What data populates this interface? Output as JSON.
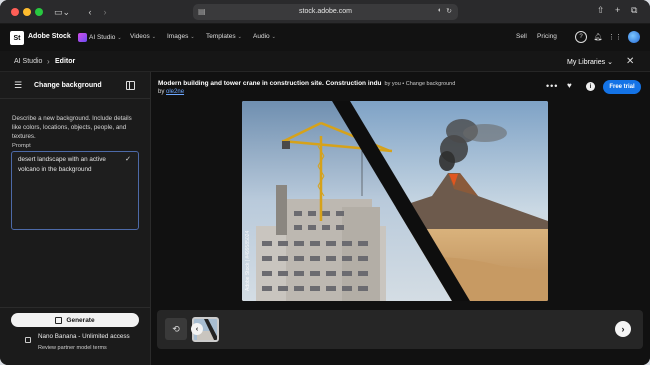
{
  "browser": {
    "url": "stock.adobe.com",
    "icons": [
      "sidebar-icon",
      "back-icon",
      "forward-icon",
      "reader-icon",
      "translate-icon",
      "reload-icon",
      "share-icon",
      "new-tab-icon",
      "tabs-icon"
    ]
  },
  "header": {
    "logo": "St",
    "brand": "Adobe Stock",
    "menu": [
      {
        "label": "AI Studio"
      },
      {
        "label": "Videos"
      },
      {
        "label": "Images"
      },
      {
        "label": "Templates"
      },
      {
        "label": "Audio"
      }
    ],
    "sell": "Sell",
    "pricing": "Pricing"
  },
  "subheader": {
    "crumb_root": "AI Studio",
    "crumb_current": "Editor",
    "my_libraries": "My Libraries"
  },
  "left_panel": {
    "title": "Change background",
    "description": "Describe a new background. Include details like colors, locations, objects, people, and textures.",
    "prompt_label": "Prompt",
    "prompt_value": "desert landscape with an active volcano in the background",
    "generate": "Generate",
    "model_name": "Nano Banana - Unlimited access",
    "model_terms": "Review partner model terms"
  },
  "main": {
    "title": "Modern building and tower crane in construction site. Construction indu",
    "title_meta": "by you • Change background",
    "by_prefix": "by",
    "author": "ole2ne",
    "free_trial": "Free trial",
    "watermark": "Adobe Stock | #499585024"
  },
  "colors": {
    "accent": "#1473e6",
    "bg": "#111111",
    "panel": "#1b1b1b"
  }
}
